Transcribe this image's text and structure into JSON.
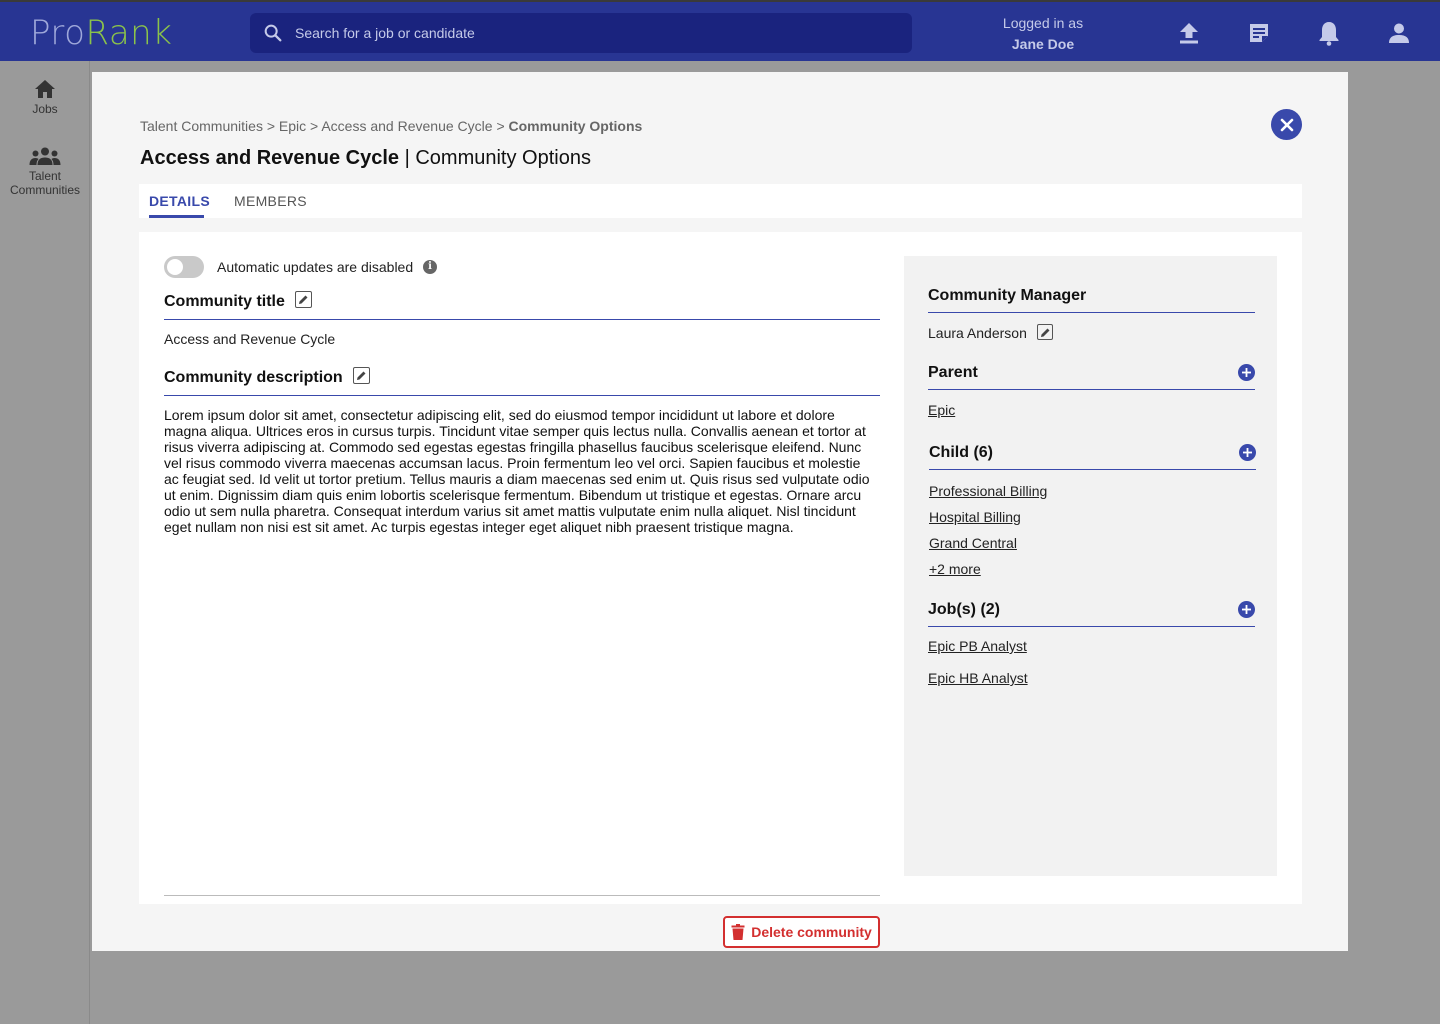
{
  "app": {
    "logo_pro": "Pro",
    "logo_rank": "Rank",
    "search_placeholder": "Search for a job or candidate",
    "logged_in_label": "Logged in as",
    "user_name": "Jane Doe"
  },
  "sidebar": {
    "items": [
      {
        "label": "Jobs",
        "icon": "home-icon"
      },
      {
        "label": "Talent Communities",
        "icon": "people-icon"
      }
    ]
  },
  "breadcrumb": {
    "items": [
      "Talent Communities",
      "Epic",
      "Access and Revenue Cycle"
    ],
    "separator": ">",
    "current": "Community Options"
  },
  "page": {
    "title_bold": "Access and Revenue Cycle",
    "title_sep": "|",
    "title_rest": "Community Options"
  },
  "tabs": [
    {
      "label": "DETAILS",
      "active": true
    },
    {
      "label": "MEMBERS",
      "active": false
    }
  ],
  "details": {
    "toggle_label": "Automatic updates are disabled",
    "toggle_on": false,
    "info_glyph": "i",
    "title_heading": "Community title",
    "title_value": "Access and Revenue Cycle",
    "description_heading": "Community description",
    "description": "Lorem ipsum dolor sit amet, consectetur adipiscing elit, sed do eiusmod tempor incididunt ut labore et dolore magna aliqua. Ultrices eros in cursus turpis. Tincidunt vitae semper quis lectus nulla. Convallis aenean et tortor at risus viverra adipiscing at. Commodo sed egestas egestas fringilla phasellus faucibus scelerisque eleifend. Nunc vel risus commodo viverra maecenas accumsan lacus. Proin fermentum leo vel orci. Sapien faucibus et molestie ac feugiat sed. Id velit ut tortor pretium. Tellus mauris a diam maecenas sed enim ut. Quis risus sed vulputate odio ut enim. Dignissim diam quis enim lobortis scelerisque fermentum. Bibendum ut tristique et egestas. Ornare arcu odio ut sem nulla pharetra. Consequat interdum varius sit amet mattis vulputate enim nulla aliquet. Nisl tincidunt eget nullam non nisi est sit amet. Ac turpis egestas integer eget aliquet nibh praesent tristique magna.",
    "delete_label": "Delete community"
  },
  "side_panel": {
    "manager_heading": "Community Manager",
    "manager_name": "Laura Anderson",
    "parent_heading": "Parent",
    "parent_link": "Epic",
    "child_heading": "Child (6)",
    "children": [
      "Professional Billing",
      "Hospital Billing",
      "Grand Central"
    ],
    "child_more": "+2 more",
    "jobs_heading": "Job(s) (2)",
    "jobs": [
      "Epic PB Analyst",
      "Epic HB Analyst"
    ]
  },
  "colors": {
    "topbar": "#283593",
    "accent": "#3949ab",
    "danger": "#d32f2f",
    "logo_rank": "#8bc34a"
  }
}
